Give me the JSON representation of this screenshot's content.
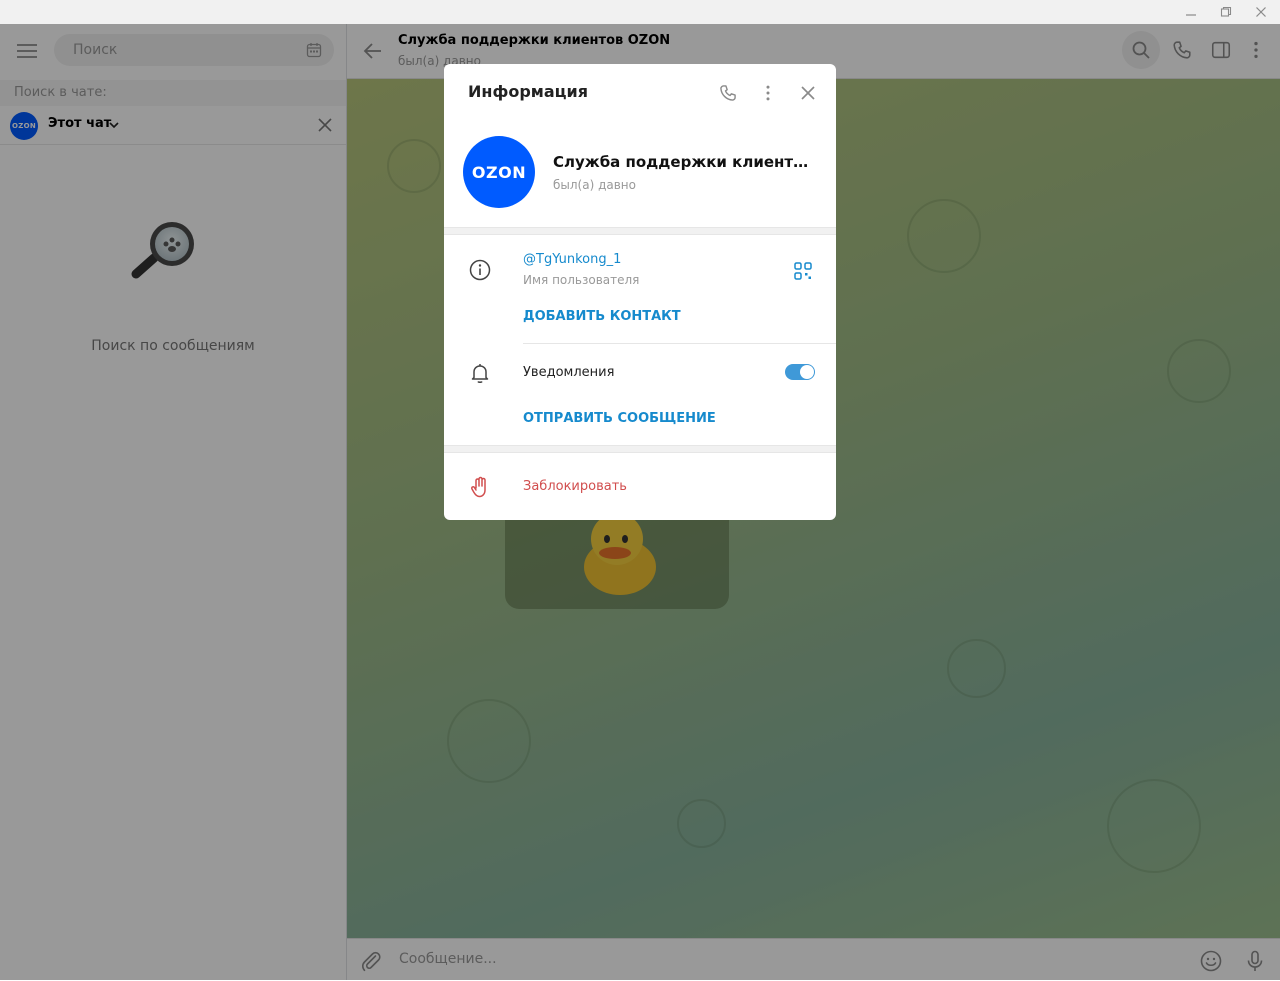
{
  "sidebar": {
    "search_placeholder": "Поиск",
    "search_in_chat_label": "Поиск в чате:",
    "filter_avatar_text": "OZON",
    "filter_label": "Этот чат",
    "empty_text": "Поиск по сообщениям"
  },
  "chat": {
    "title": "Служба поддержки клиентов OZON",
    "status": "был(а) давно",
    "composer_placeholder": "Сообщение..."
  },
  "modal": {
    "title": "Информация",
    "avatar_text": "OZON",
    "name": "Служба поддержки клиентов OZON",
    "status": "был(а) давно",
    "username": "@TgYunkong_1",
    "username_label": "Имя пользователя",
    "add_contact": "ДОБАВИТЬ КОНТАКТ",
    "notifications_label": "Уведомления",
    "notifications_enabled": true,
    "send_message": "ОТПРАВИТЬ СООБЩЕНИЕ",
    "block": "Заблокировать"
  },
  "colors": {
    "accent": "#168acd",
    "toggle": "#3f99d8",
    "danger": "#d14e4e",
    "ozon_blue": "#005bff"
  },
  "icons": [
    "minimize-icon",
    "maximize-icon",
    "window-close-icon",
    "menu-icon",
    "calendar-icon",
    "chevron-down-icon",
    "close-icon",
    "magnifier-icon",
    "back-arrow-icon",
    "search-icon",
    "phone-icon",
    "sidebar-panel-icon",
    "more-vertical-icon",
    "info-icon",
    "qr-code-icon",
    "bell-icon",
    "hand-stop-icon",
    "paperclip-icon",
    "emoji-icon",
    "microphone-icon"
  ]
}
